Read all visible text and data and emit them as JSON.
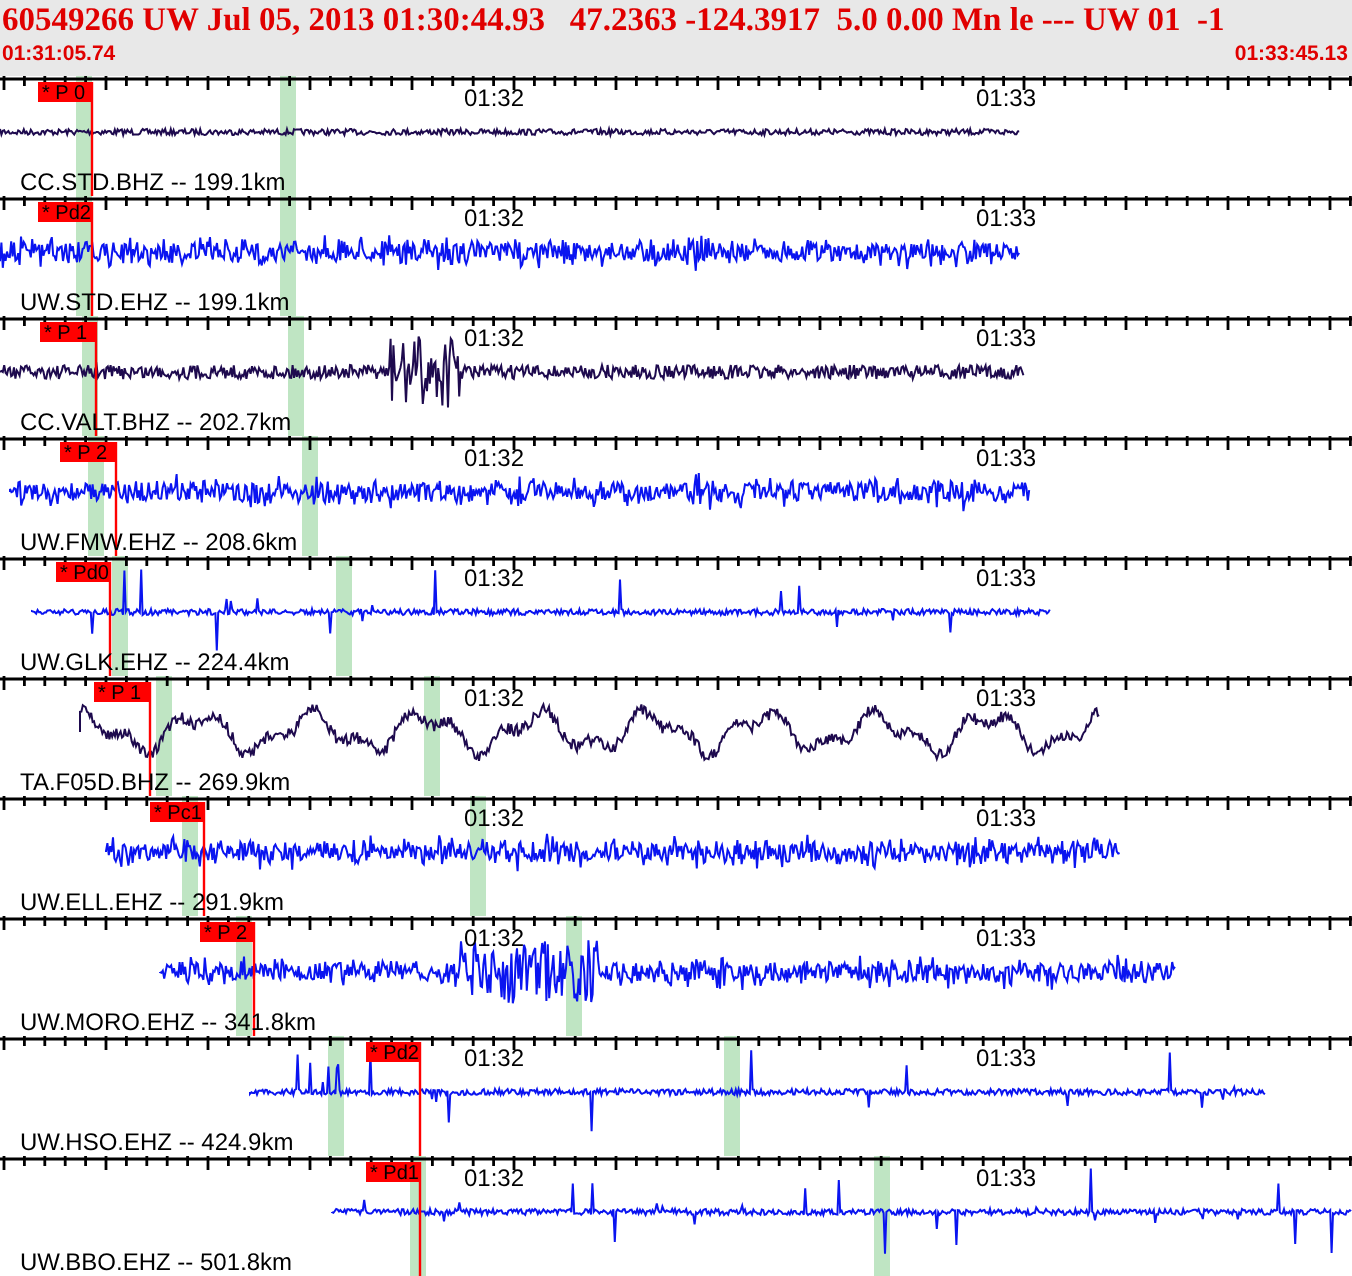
{
  "header": {
    "title": "60549266 UW Jul 05, 2013 01:30:44.93   47.2363 -124.3917  5.0 0.00 Mn le --- UW 01  -1",
    "start_time": "01:31:05.74",
    "end_time": "01:33:45.13"
  },
  "traces": [
    {
      "label": "CC.STD.BHZ -- 199.1km",
      "pick": "* P 0",
      "color": "#1e0a4e",
      "time_labels": [
        "01:32",
        "01:33"
      ]
    },
    {
      "label": "UW.STD.EHZ -- 199.1km",
      "pick": "* Pd2",
      "color": "#0a14f0",
      "time_labels": [
        "01:32",
        "01:33"
      ]
    },
    {
      "label": "CC.VALT.BHZ -- 202.7km",
      "pick": "* P 1",
      "color": "#1e0a4e",
      "time_labels": [
        "01:32",
        "01:33"
      ]
    },
    {
      "label": "UW.FMW.EHZ -- 208.6km",
      "pick": "* P 2",
      "color": "#0a14f0",
      "time_labels": [
        "01:32",
        "01:33"
      ]
    },
    {
      "label": "UW.GLK.EHZ -- 224.4km",
      "pick": "* Pd0",
      "color": "#0a14f0",
      "time_labels": [
        "01:32",
        "01:33"
      ]
    },
    {
      "label": "TA.F05D.BHZ -- 269.9km",
      "pick": "* P 1",
      "color": "#1e0a4e",
      "time_labels": [
        "01:32",
        "01:33"
      ]
    },
    {
      "label": "UW.ELL.EHZ -- 291.9km",
      "pick": "* Pc1",
      "color": "#0a14f0",
      "time_labels": [
        "01:32",
        "01:33"
      ]
    },
    {
      "label": "UW.MORO.EHZ -- 341.8km",
      "pick": "* P 2",
      "color": "#0a14f0",
      "time_labels": [
        "01:32",
        "01:33"
      ]
    },
    {
      "label": "UW.HSO.EHZ -- 424.9km",
      "pick": "* Pd2",
      "color": "#0a14f0",
      "time_labels": [
        "01:32",
        "01:33"
      ]
    },
    {
      "label": "UW.BBO.EHZ -- 501.8km",
      "pick": "* Pd1",
      "color": "#0a14f0",
      "time_labels": [
        "01:32",
        "01:33"
      ]
    }
  ]
}
